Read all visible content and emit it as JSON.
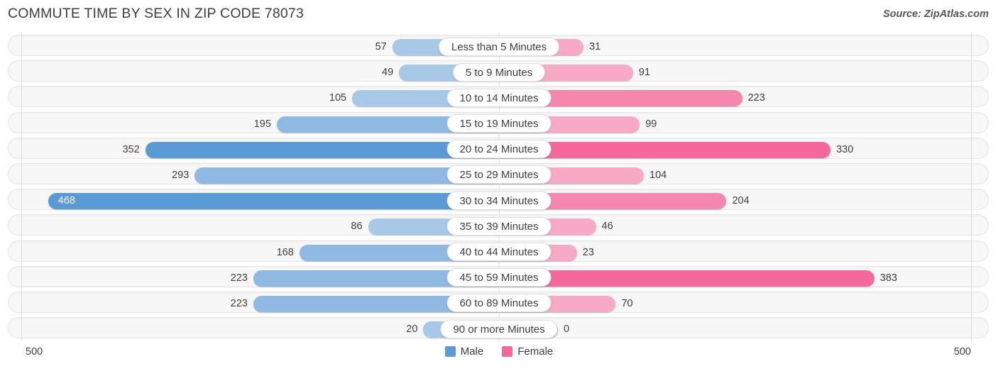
{
  "header": {
    "title": "COMMUTE TIME BY SEX IN ZIP CODE 78073",
    "source": "Source: ZipAtlas.com"
  },
  "axis": {
    "left_max_label": "500",
    "right_max_label": "500",
    "max": 500
  },
  "legend": {
    "items": [
      {
        "label": "Male",
        "color": "#5b9bd5"
      },
      {
        "label": "Female",
        "color": "#f4689c"
      }
    ]
  },
  "colors": {
    "male_light": "#a8c8e8",
    "male_mid": "#8fb9e3",
    "male_dark": "#5b9bd5",
    "female_light": "#f8a9c6",
    "female_mid": "#f587ae",
    "female_dark": "#f4689c",
    "track_bg": "#f7f7f7",
    "track_border": "#e6e6e6",
    "gridline": "#d9d9d9"
  },
  "chart_data": {
    "type": "bar",
    "title": "COMMUTE TIME BY SEX IN ZIP CODE 78073",
    "subtitle": "Source: ZipAtlas.com",
    "orientation": "horizontal-diverging",
    "xlabel": "",
    "ylabel": "",
    "xlim": [
      -500,
      500
    ],
    "axis_max": 500,
    "grid": true,
    "legend_position": "bottom-center",
    "categories": [
      "Less than 5 Minutes",
      "5 to 9 Minutes",
      "10 to 14 Minutes",
      "15 to 19 Minutes",
      "20 to 24 Minutes",
      "25 to 29 Minutes",
      "30 to 34 Minutes",
      "35 to 39 Minutes",
      "40 to 44 Minutes",
      "45 to 59 Minutes",
      "60 to 89 Minutes",
      "90 or more Minutes"
    ],
    "series": [
      {
        "name": "Male",
        "color": "#5b9bd5",
        "values": [
          57,
          49,
          105,
          195,
          352,
          293,
          468,
          86,
          168,
          223,
          223,
          20
        ]
      },
      {
        "name": "Female",
        "color": "#f4689c",
        "values": [
          31,
          91,
          223,
          99,
          330,
          104,
          204,
          46,
          23,
          383,
          70,
          0
        ]
      }
    ]
  }
}
